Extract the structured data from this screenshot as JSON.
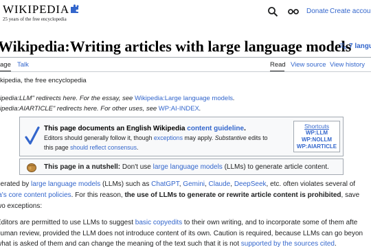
{
  "header": {
    "logo_word": "WIKIPEDIA",
    "logo_tagline": "25 years of the free encyclopedia",
    "donate_label": "Donate",
    "create_account_label": "Create account"
  },
  "page": {
    "title": "Wikipedia:Writing articles with large language models",
    "language_button": "7 langu"
  },
  "tabs": {
    "page": "age",
    "talk": "Talk",
    "read": "Read",
    "view_source": "View source",
    "view_history": "View history"
  },
  "from_line": "kipedia, the free encyclopedia",
  "hatnotes": [
    {
      "prefix": "ipedia:LLM\" redirects here. For the essay, see ",
      "link": "Wikipedia:Large language models",
      "suffix": "."
    },
    {
      "prefix": "ipedia:AIARTICLE\" redirects here. For other uses, see ",
      "link": "WP:AI-INDEX",
      "suffix": "."
    }
  ],
  "guideline_box": {
    "title_prefix": "This page documents an English Wikipedia ",
    "title_link": "content guideline",
    "title_suffix": ".",
    "line2_a": "Editors should generally follow it, though ",
    "line2_link": "exceptions",
    "line2_b": " may apply. ",
    "line2_italic": "Substantive",
    "line2_c": " edits to",
    "line3_a": "this page ",
    "line3_link": "should reflect consensus",
    "line3_b": ".",
    "shortcuts_title": "Shortcuts",
    "shortcuts": [
      "WP:LLM",
      "WP:NOLLM",
      "WP:AIARTICLE"
    ]
  },
  "nutshell_box": {
    "bold": "This page in a nutshell:",
    "text_a": " Don't use ",
    "link": "large language models",
    "text_b": " (LLMs) to generate article content."
  },
  "body": {
    "p1_a": "nerated by ",
    "p1_l1": "large language models",
    "p1_b": " (LLMs) such as ",
    "p1_l2": "ChatGPT",
    "p1_c": ", ",
    "p1_l3": "Gemini",
    "p1_d": ", ",
    "p1_l4": "Claude",
    "p1_e": ", ",
    "p1_l5": "DeepSeek",
    "p1_f": ", etc. often violates several of",
    "p2_l1": "ia's core content policies",
    "p2_a": ". For this reason, ",
    "p2_bold": "the use of LLMs to generate or rewrite article content is prohibited",
    "p2_b": ", save",
    "p3": "wo exceptions:",
    "p4_a": "Editors are permitted to use LLMs to suggest ",
    "p4_link": "basic copyedits",
    "p4_b": " to their own writing, and to incorporate some of them afte",
    "p5": "human review, provided the LLM does not introduce content of its own. Caution is required, because LLMs can go beyon",
    "p6_a": "what is asked of them and can change the meaning of the text such that it is not ",
    "p6_link": "supported by the sources cited",
    "p6_b": "."
  },
  "colors": {
    "link": "#3366cc",
    "text": "#202122",
    "box_bg": "#f8f9fa",
    "box_border": "#a2a9b1",
    "check": "#36c"
  }
}
